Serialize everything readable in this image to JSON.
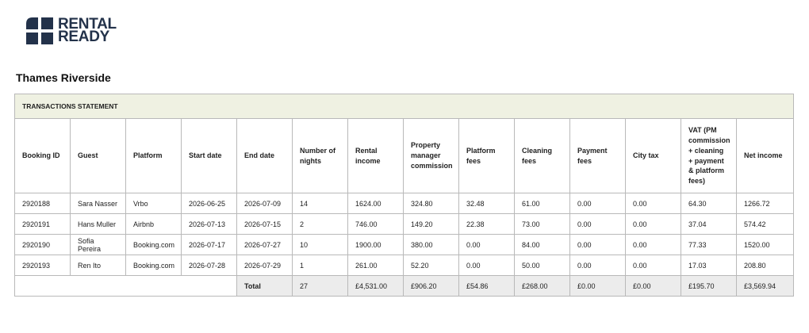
{
  "brand": {
    "line1": "RENTAL",
    "line2": "READY",
    "color": "#23324a"
  },
  "property_name": "Thames Riverside",
  "statement": {
    "section_title": "TRANSACTIONS STATEMENT",
    "columns": [
      "Booking ID",
      "Guest",
      "Platform",
      "Start date",
      "End date",
      "Number of nights",
      "Rental income",
      "Property manager commission",
      "Platform fees",
      "Cleaning fees",
      "Payment fees",
      "City tax",
      "VAT (PM commission + cleaning + payment & platform fees)",
      "Net income"
    ],
    "rows": [
      [
        "2920188",
        "Sara Nasser",
        "Vrbo",
        "2026-06-25",
        "2026-07-09",
        "14",
        "1624.00",
        "324.80",
        "32.48",
        "61.00",
        "0.00",
        "0.00",
        "64.30",
        "1266.72"
      ],
      [
        "2920191",
        "Hans Muller",
        "Airbnb",
        "2026-07-13",
        "2026-07-15",
        "2",
        "746.00",
        "149.20",
        "22.38",
        "73.00",
        "0.00",
        "0.00",
        "37.04",
        "574.42"
      ],
      [
        "2920190",
        "Sofia Pereira",
        "Booking.com",
        "2026-07-17",
        "2026-07-27",
        "10",
        "1900.00",
        "380.00",
        "0.00",
        "84.00",
        "0.00",
        "0.00",
        "77.33",
        "1520.00"
      ],
      [
        "2920193",
        "Ren Ito",
        "Booking.com",
        "2026-07-28",
        "2026-07-29",
        "1",
        "261.00",
        "52.20",
        "0.00",
        "50.00",
        "0.00",
        "0.00",
        "17.03",
        "208.80"
      ]
    ],
    "totals": {
      "label": "Total",
      "nights": "27",
      "rental_income": "£4,531.00",
      "pm_commission": "£906.20",
      "platform_fees": "£54.86",
      "cleaning_fees": "£268.00",
      "payment_fees": "£0.00",
      "city_tax": "£0.00",
      "vat": "£195.70",
      "net_income": "£3,569.94"
    }
  }
}
